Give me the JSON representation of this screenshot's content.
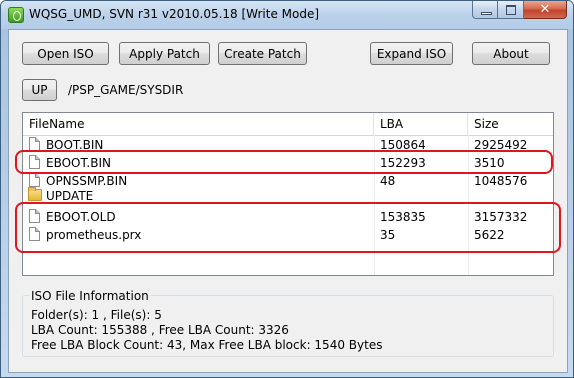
{
  "window": {
    "title": "WQSG_UMD, SVN r31 v2010.05.18 [Write Mode]"
  },
  "toolbar": {
    "open_iso": "Open ISO",
    "apply_patch": "Apply Patch",
    "create_patch": "Create Patch",
    "expand_iso": "Expand ISO",
    "about": "About"
  },
  "path": {
    "up_label": "UP",
    "current": "/PSP_GAME/SYSDIR"
  },
  "file_list": {
    "columns": [
      "FileName",
      "LBA",
      "Size"
    ],
    "rows": [
      {
        "type": "file",
        "name": "BOOT.BIN",
        "lba": "150864",
        "size": "2925492"
      },
      {
        "type": "file",
        "name": "EBOOT.BIN",
        "lba": "152293",
        "size": "3510"
      },
      {
        "type": "file",
        "name": "OPNSSMP.BIN",
        "lba": "48",
        "size": "1048576"
      },
      {
        "type": "folder",
        "name": "UPDATE",
        "lba": "",
        "size": ""
      },
      {
        "type": "file",
        "name": "EBOOT.OLD",
        "lba": "153835",
        "size": "3157332"
      },
      {
        "type": "file",
        "name": "prometheus.prx",
        "lba": "35",
        "size": "5622"
      }
    ]
  },
  "info": {
    "title": "ISO File Information",
    "line1": "Folder(s): 1 , File(s): 5",
    "line2": "LBA Count: 155388 , Free LBA Count: 3326",
    "line3": "Free LBA Block Count: 43, Max Free LBA block: 1540 Bytes"
  },
  "colors": {
    "highlight": "#e0161f",
    "title_bar": "#bcd2ea"
  },
  "icons": {
    "app": "wqsg-app-icon",
    "file": "file-icon",
    "folder": "folder-icon"
  }
}
